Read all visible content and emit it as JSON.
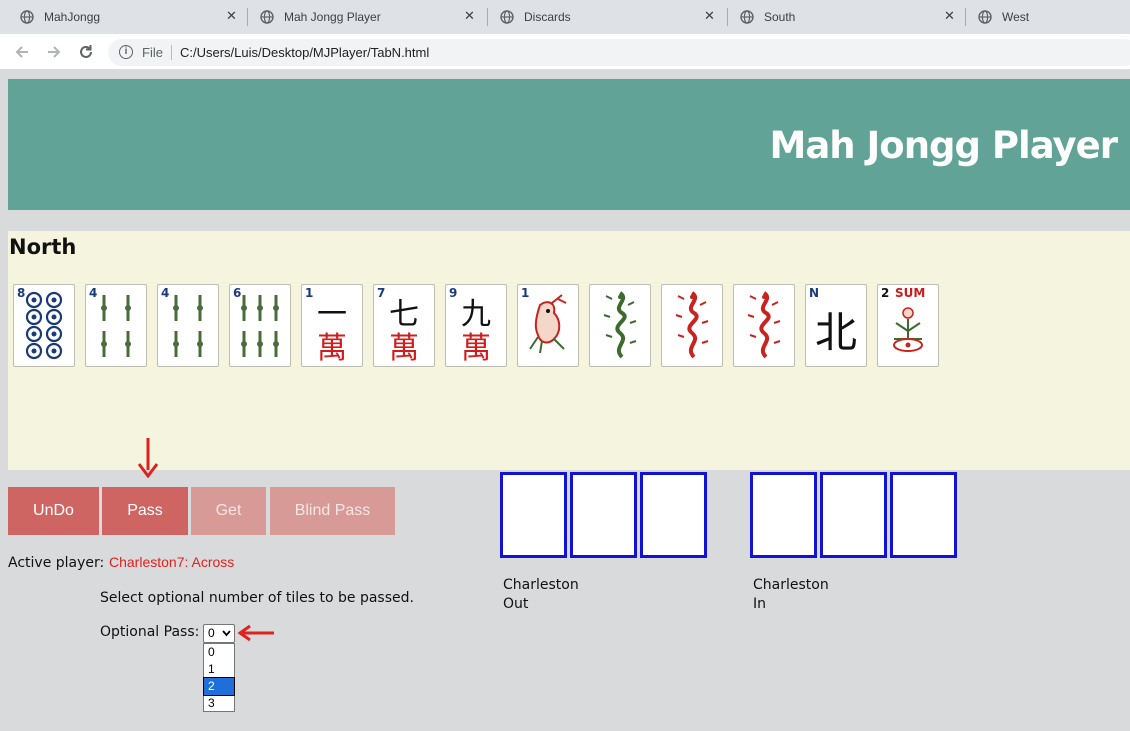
{
  "browser": {
    "tabs": [
      {
        "title": "MahJongg",
        "active": false
      },
      {
        "title": "Mah Jongg Player",
        "active": false
      },
      {
        "title": "Discards",
        "active": false
      },
      {
        "title": "South",
        "active": true
      },
      {
        "title": "West",
        "active": false
      }
    ],
    "close_glyph": "✕",
    "back_icon": "arrow-left-icon",
    "forward_icon": "arrow-right-icon",
    "reload_icon": "reload-icon",
    "address": {
      "scheme": "File",
      "url": "C:/Users/Luis/Desktop/MJPlayer/TabN.html"
    }
  },
  "page": {
    "title": "Mah Jongg Player",
    "player_name": "North",
    "colors": {
      "banner": "#61a396",
      "hand_bg": "#f5f5df",
      "button_active": "#cf6562",
      "button_disabled": "#d79a96",
      "slot_border": "#1212d4",
      "status_text": "#e0211d"
    },
    "hand": [
      {
        "corner": "8",
        "suit": "dots",
        "name": "8 dot"
      },
      {
        "corner": "4",
        "suit": "bams",
        "name": "4 bam"
      },
      {
        "corner": "4",
        "suit": "bams",
        "name": "4 bam"
      },
      {
        "corner": "6",
        "suit": "bams",
        "name": "6 bam"
      },
      {
        "corner": "1",
        "suit": "craks",
        "char": "一",
        "name": "1 crak"
      },
      {
        "corner": "7",
        "suit": "craks",
        "char": "七",
        "name": "7 crak"
      },
      {
        "corner": "9",
        "suit": "craks",
        "char": "九",
        "name": "9 crak"
      },
      {
        "corner": "1",
        "suit": "bams",
        "name": "1 bam bird"
      },
      {
        "corner": "",
        "suit": "dragon",
        "name": "green dragon"
      },
      {
        "corner": "",
        "suit": "dragon",
        "name": "red dragon"
      },
      {
        "corner": "",
        "suit": "dragon",
        "name": "red dragon"
      },
      {
        "corner": "N",
        "suit": "wind",
        "char": "北",
        "name": "north wind"
      },
      {
        "corner": "2",
        "corner_extra": "SUM",
        "suit": "flower",
        "name": "flower summer"
      }
    ],
    "buttons": {
      "undo": "UnDo",
      "pass": "Pass",
      "get": "Get",
      "blind_pass": "Blind Pass"
    },
    "active_player_label": "Active player:",
    "active_player_value": "Charleston7: Across",
    "instruction": "Select optional number of tiles to be passed.",
    "optional_pass": {
      "label": "Optional Pass:",
      "selected": "0",
      "options": [
        "0",
        "1",
        "2",
        "3"
      ],
      "highlighted": "2"
    },
    "charleston_out": {
      "line1": "Charleston",
      "line2": "Out"
    },
    "charleston_in": {
      "line1": "Charleston",
      "line2": "In"
    }
  }
}
